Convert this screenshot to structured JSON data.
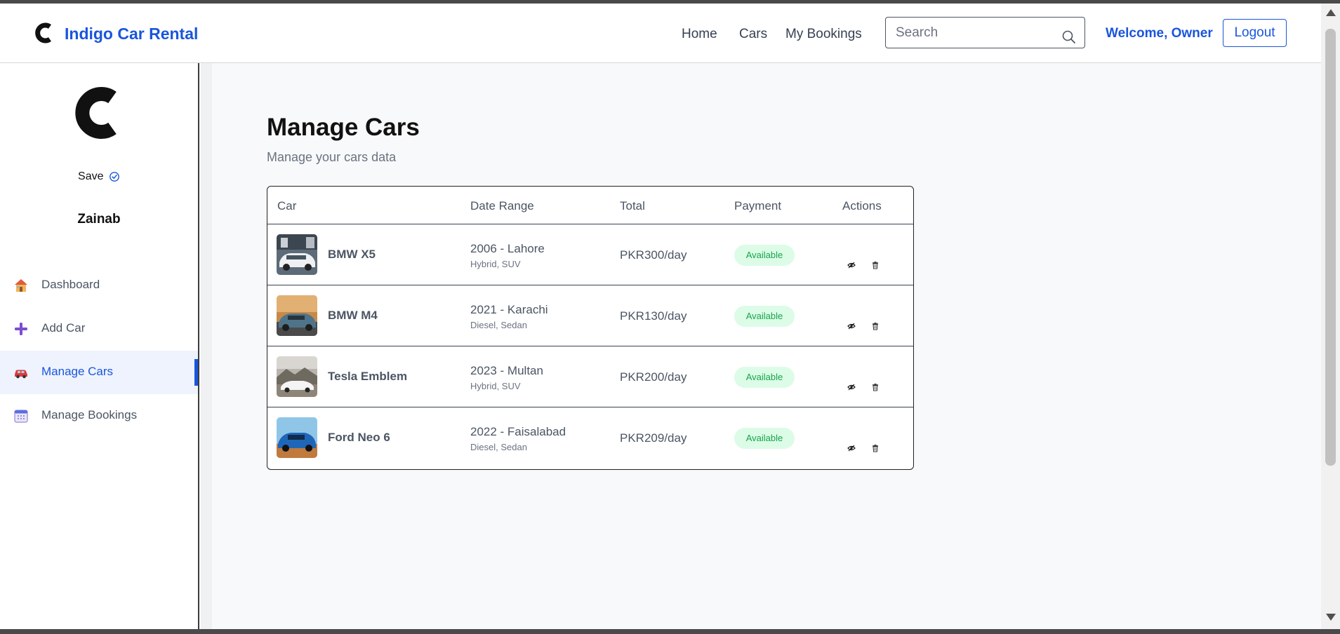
{
  "brand": {
    "name": "Indigo Car Rental"
  },
  "nav": {
    "links": [
      "Home",
      "Cars",
      "My Bookings"
    ],
    "search_placeholder": "Search",
    "welcome": "Welcome, Owner",
    "logout": "Logout"
  },
  "sidebar": {
    "save_label": "Save",
    "user_name": "Zainab",
    "items": [
      {
        "label": "Dashboard",
        "icon": "house-icon"
      },
      {
        "label": "Add Car",
        "icon": "plus-icon"
      },
      {
        "label": "Manage Cars",
        "icon": "car-icon",
        "active": true
      },
      {
        "label": "Manage Bookings",
        "icon": "calendar-icon"
      }
    ]
  },
  "main": {
    "title": "Manage Cars",
    "subtitle": "Manage your cars data",
    "table": {
      "headers": [
        "Car",
        "Date Range",
        "Total",
        "Payment",
        "Actions"
      ],
      "rows": [
        {
          "car": "BMW X5",
          "date": "2006 - Lahore",
          "meta": "Hybrid, SUV",
          "total": "PKR300/day",
          "payment": "Available"
        },
        {
          "car": "BMW M4",
          "date": "2021 - Karachi",
          "meta": "Diesel, Sedan",
          "total": "PKR130/day",
          "payment": "Available"
        },
        {
          "car": "Tesla Emblem",
          "date": "2023 - Multan",
          "meta": "Hybrid, SUV",
          "total": "PKR200/day",
          "payment": "Available"
        },
        {
          "car": "Ford Neo 6",
          "date": "2022 - Faisalabad",
          "meta": "Diesel, Sedan",
          "total": "PKR209/day",
          "payment": "Available"
        }
      ]
    }
  },
  "colors": {
    "accent": "#1a56db",
    "badge_bg": "#dcfce7",
    "badge_text": "#16a34a"
  }
}
